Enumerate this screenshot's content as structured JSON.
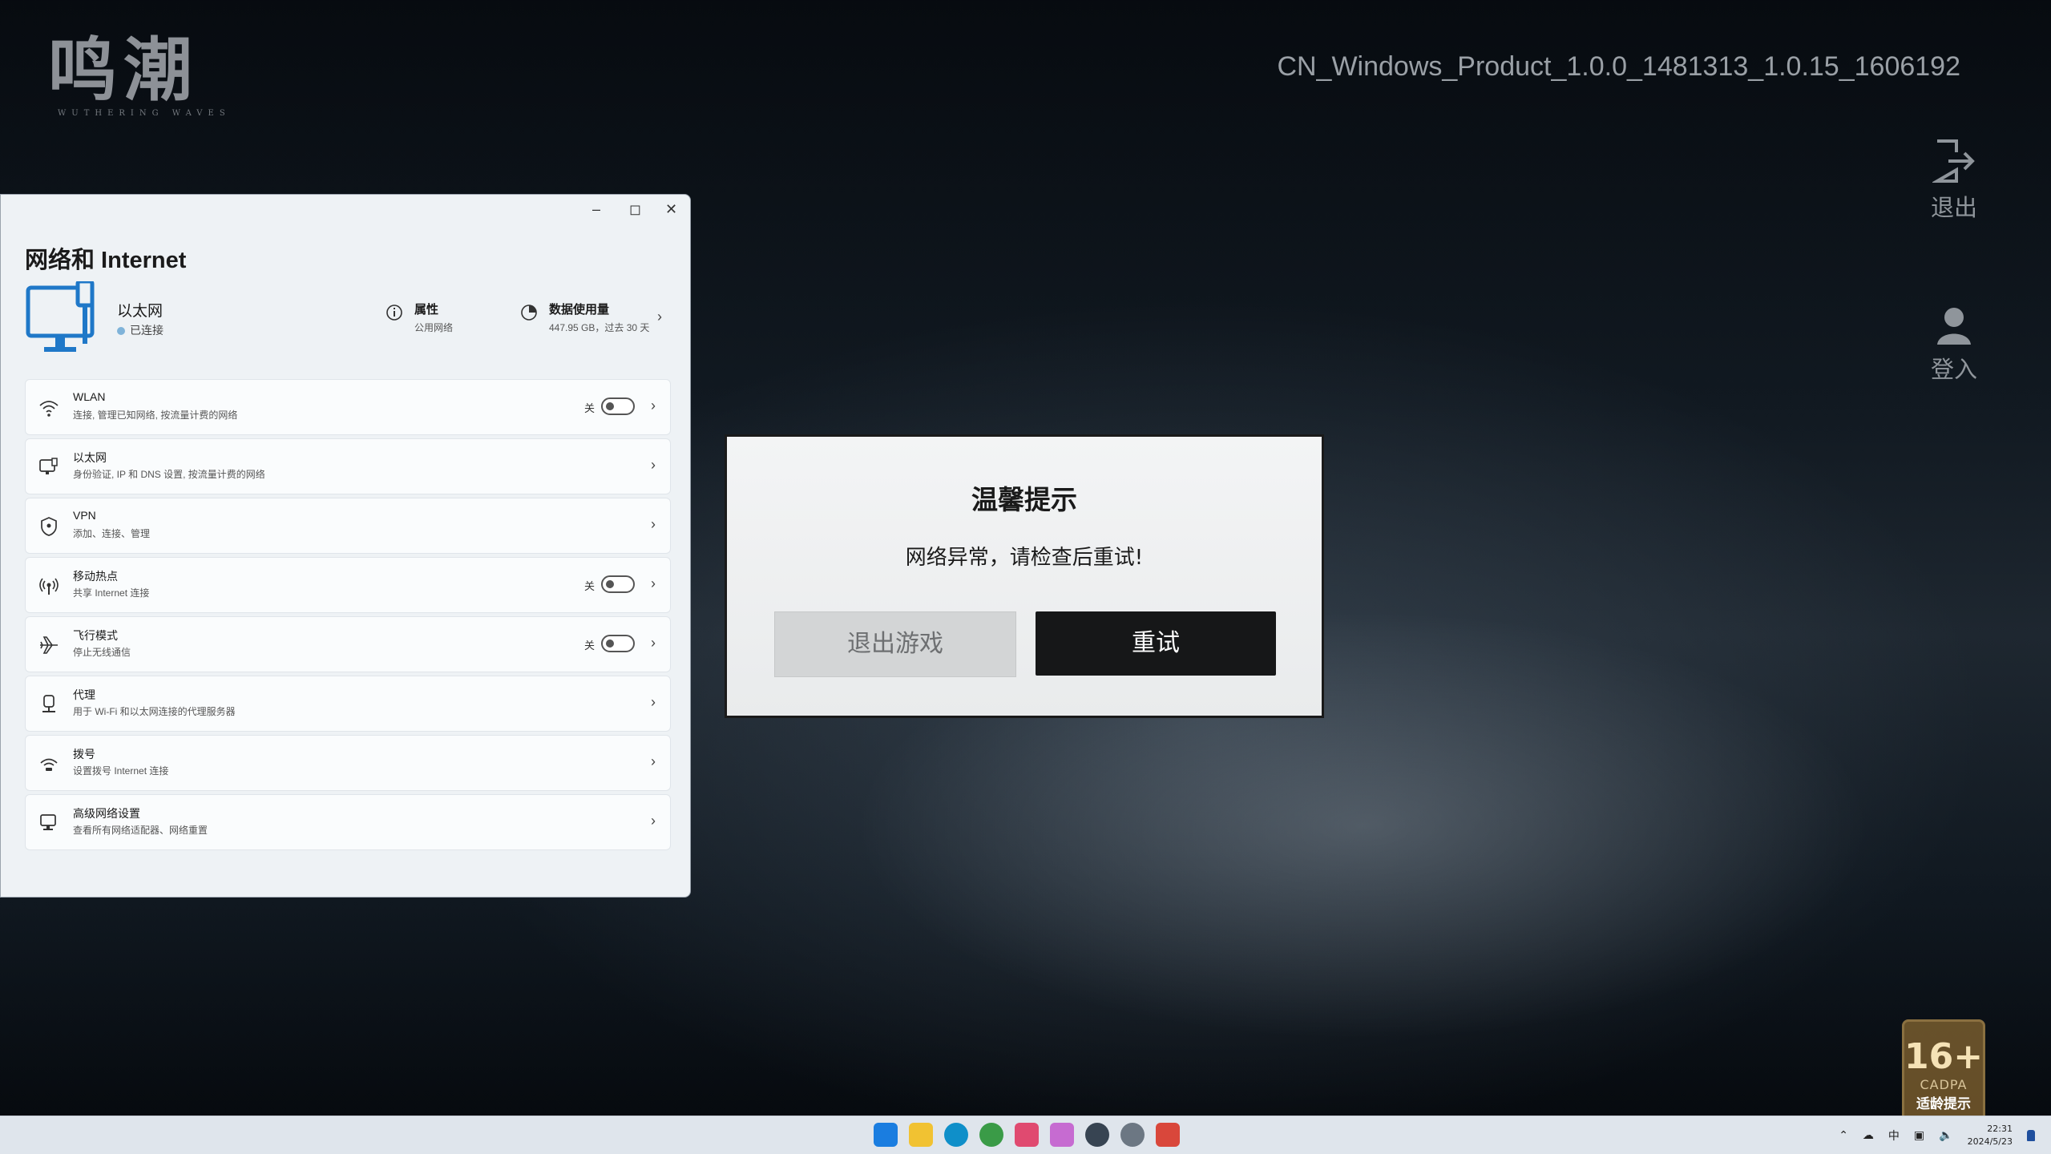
{
  "game": {
    "logo_text": "鸣潮",
    "logo_subtext": "WUTHERING WAVES",
    "version": "CN_Windows_Product_1.0.0_1481313_1.0.15_1606192",
    "exit_label": "退出",
    "login_label": "登入",
    "age_badge": {
      "age": "16+",
      "org": "CADPA",
      "tip": "适龄提示"
    }
  },
  "settings": {
    "title": "网络和 Internet",
    "ethernet": {
      "name": "以太网",
      "status": "已连接"
    },
    "properties": {
      "label": "属性",
      "sub": "公用网络"
    },
    "data_usage": {
      "label": "数据使用量",
      "sub": "447.95 GB，过去 30 天"
    },
    "items": [
      {
        "label": "WLAN",
        "desc": "连接, 管理已知网络, 按流量计费的网络",
        "icon": "wifi-icon",
        "toggle": "关"
      },
      {
        "label": "以太网",
        "desc": "身份验证, IP 和 DNS 设置, 按流量计费的网络",
        "icon": "ethernet-icon"
      },
      {
        "label": "VPN",
        "desc": "添加、连接、管理",
        "icon": "shield-icon"
      },
      {
        "label": "移动热点",
        "desc": "共享 Internet 连接",
        "icon": "hotspot-icon",
        "toggle": "关"
      },
      {
        "label": "飞行模式",
        "desc": "停止无线通信",
        "icon": "airplane-icon",
        "toggle": "关"
      },
      {
        "label": "代理",
        "desc": "用于 Wi-Fi 和以太网连接的代理服务器",
        "icon": "proxy-icon"
      },
      {
        "label": "拨号",
        "desc": "设置拨号 Internet 连接",
        "icon": "dialup-icon"
      },
      {
        "label": "高级网络设置",
        "desc": "查看所有网络适配器、网络重置",
        "icon": "advanced-network-icon"
      }
    ]
  },
  "dialog": {
    "title": "温馨提示",
    "message": "网络异常，请检查后重试!",
    "quit_label": "退出游戏",
    "retry_label": "重试"
  },
  "taskbar": {
    "tray_ime": "中",
    "time": "22:31",
    "date": "2024/5/23"
  }
}
